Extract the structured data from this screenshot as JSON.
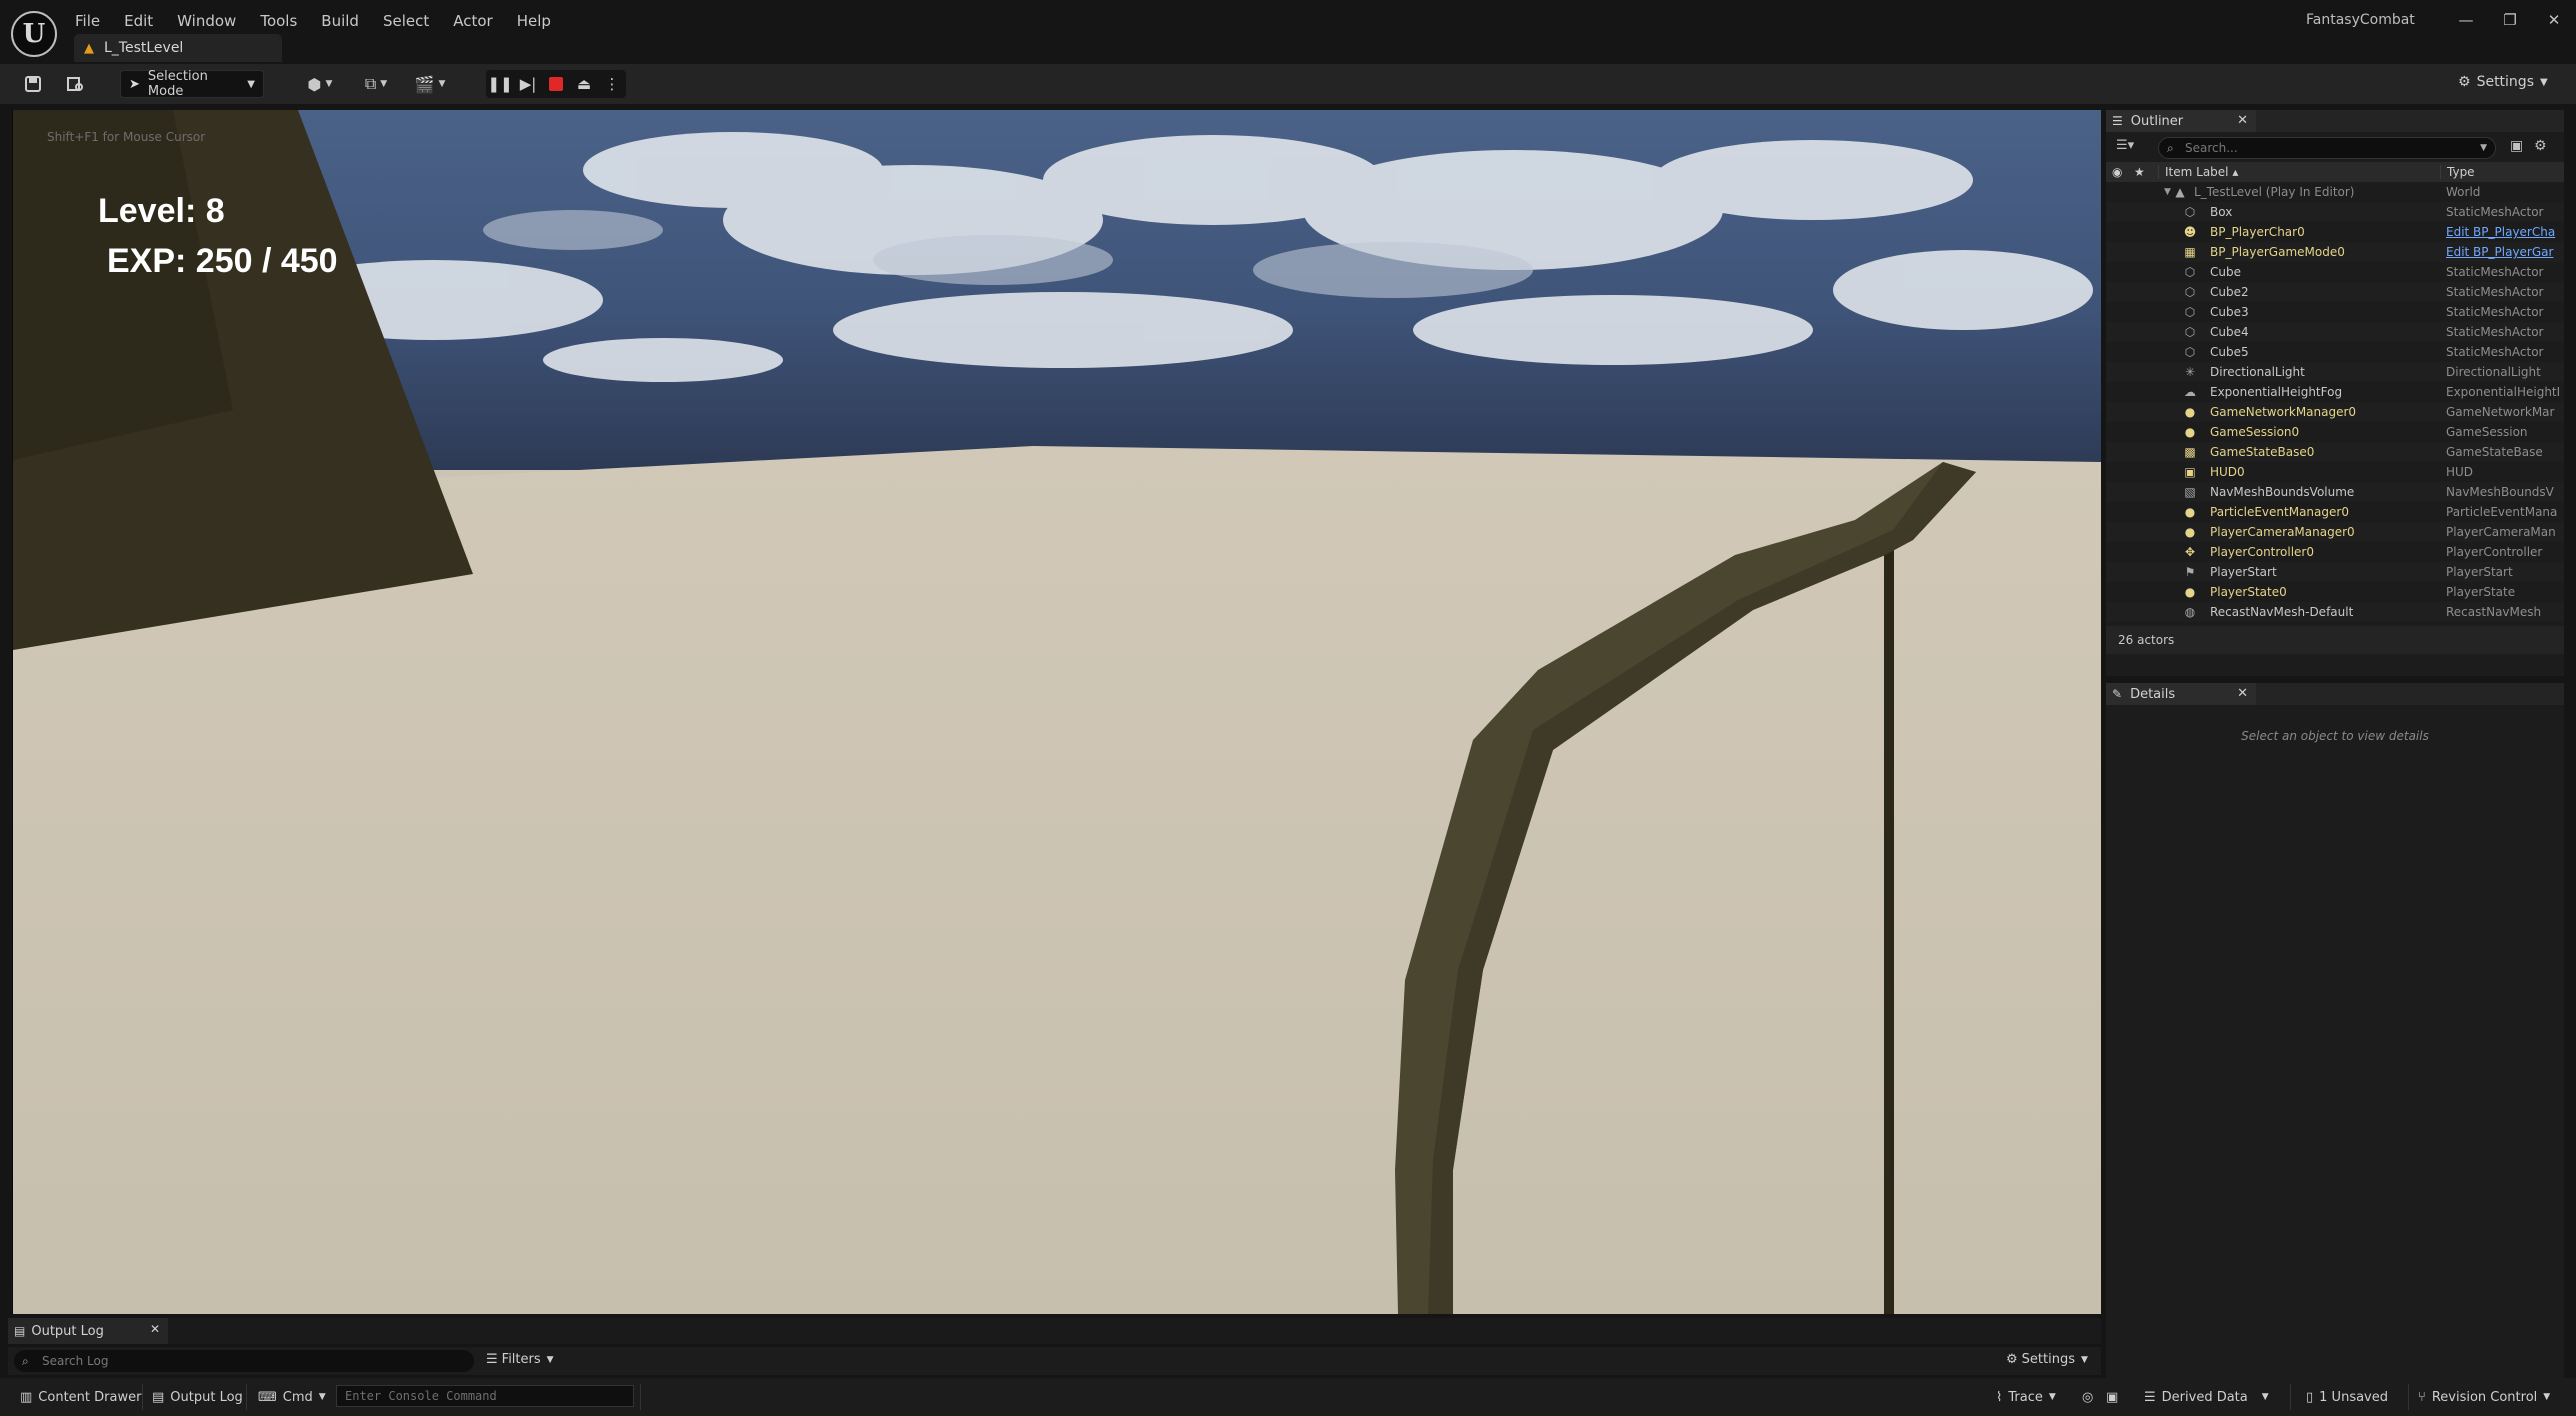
{
  "app": {
    "project_name": "FantasyCombat",
    "level_tab": "L_TestLevel",
    "logo_glyph": "U"
  },
  "menu": [
    "File",
    "Edit",
    "Window",
    "Tools",
    "Build",
    "Select",
    "Actor",
    "Help"
  ],
  "toolbar": {
    "selection_mode": "Selection Mode",
    "settings": "Settings"
  },
  "viewport": {
    "hint": "Shift+F1 for Mouse Cursor",
    "hud_level": "Level: 8",
    "hud_exp": "EXP: 250 / 450"
  },
  "outliner": {
    "tab": "Outliner",
    "search_placeholder": "Search...",
    "col_label": "Item Label ▴",
    "col_type": "Type",
    "root": {
      "label": "L_TestLevel (Play In Editor)",
      "type": "World"
    },
    "rows": [
      {
        "label": "Box",
        "type": "StaticMeshActor",
        "icon": "cube-icon",
        "hl": false,
        "link": false
      },
      {
        "label": "BP_PlayerChar0",
        "type": "Edit BP_PlayerCha",
        "icon": "character-icon",
        "hl": true,
        "link": true
      },
      {
        "label": "BP_PlayerGameMode0",
        "type": "Edit BP_PlayerGar",
        "icon": "gamemode-icon",
        "hl": true,
        "link": true
      },
      {
        "label": "Cube",
        "type": "StaticMeshActor",
        "icon": "cube-icon",
        "hl": false,
        "link": false
      },
      {
        "label": "Cube2",
        "type": "StaticMeshActor",
        "icon": "cube-icon",
        "hl": false,
        "link": false
      },
      {
        "label": "Cube3",
        "type": "StaticMeshActor",
        "icon": "cube-icon",
        "hl": false,
        "link": false
      },
      {
        "label": "Cube4",
        "type": "StaticMeshActor",
        "icon": "cube-icon",
        "hl": false,
        "link": false
      },
      {
        "label": "Cube5",
        "type": "StaticMeshActor",
        "icon": "cube-icon",
        "hl": false,
        "link": false
      },
      {
        "label": "DirectionalLight",
        "type": "DirectionalLight",
        "icon": "light-icon",
        "hl": false,
        "link": false
      },
      {
        "label": "ExponentialHeightFog",
        "type": "ExponentialHeightI",
        "icon": "fog-icon",
        "hl": false,
        "link": false
      },
      {
        "label": "GameNetworkManager0",
        "type": "GameNetworkMar",
        "icon": "actor-icon",
        "hl": true,
        "link": false
      },
      {
        "label": "GameSession0",
        "type": "GameSession",
        "icon": "actor-icon",
        "hl": true,
        "link": false
      },
      {
        "label": "GameStateBase0",
        "type": "GameStateBase",
        "icon": "gamestate-icon",
        "hl": true,
        "link": false
      },
      {
        "label": "HUD0",
        "type": "HUD",
        "icon": "hud-icon",
        "hl": true,
        "link": false
      },
      {
        "label": "NavMeshBoundsVolume",
        "type": "NavMeshBoundsV",
        "icon": "volume-icon",
        "hl": false,
        "link": false
      },
      {
        "label": "ParticleEventManager0",
        "type": "ParticleEventMana",
        "icon": "actor-icon",
        "hl": true,
        "link": false
      },
      {
        "label": "PlayerCameraManager0",
        "type": "PlayerCameraMan",
        "icon": "actor-icon",
        "hl": true,
        "link": false
      },
      {
        "label": "PlayerController0",
        "type": "PlayerController",
        "icon": "controller-icon",
        "hl": true,
        "link": false
      },
      {
        "label": "PlayerStart",
        "type": "PlayerStart",
        "icon": "playerstart-icon",
        "hl": false,
        "link": false
      },
      {
        "label": "PlayerState0",
        "type": "PlayerState",
        "icon": "actor-icon",
        "hl": true,
        "link": false
      },
      {
        "label": "RecastNavMesh-Default",
        "type": "RecastNavMesh",
        "icon": "navmesh-icon",
        "hl": false,
        "link": false
      }
    ],
    "count": "26 actors"
  },
  "details": {
    "tab": "Details",
    "empty": "Select an object to view details"
  },
  "log": {
    "tab": "Output Log",
    "search_placeholder": "Search Log",
    "filters": "Filters",
    "settings": "Settings"
  },
  "status": {
    "content_drawer": "Content Drawer",
    "output_log": "Output Log",
    "cmd": "Cmd",
    "console_placeholder": "Enter Console Command",
    "trace": "Trace",
    "derived_data": "Derived Data",
    "unsaved": "1 Unsaved",
    "revision_control": "Revision Control"
  },
  "colors": {
    "highlight": "#e5d48a",
    "link": "#6fa8ff",
    "normal": "#c8c8c8",
    "type": "#8e8e8e",
    "stop": "#e02828"
  }
}
